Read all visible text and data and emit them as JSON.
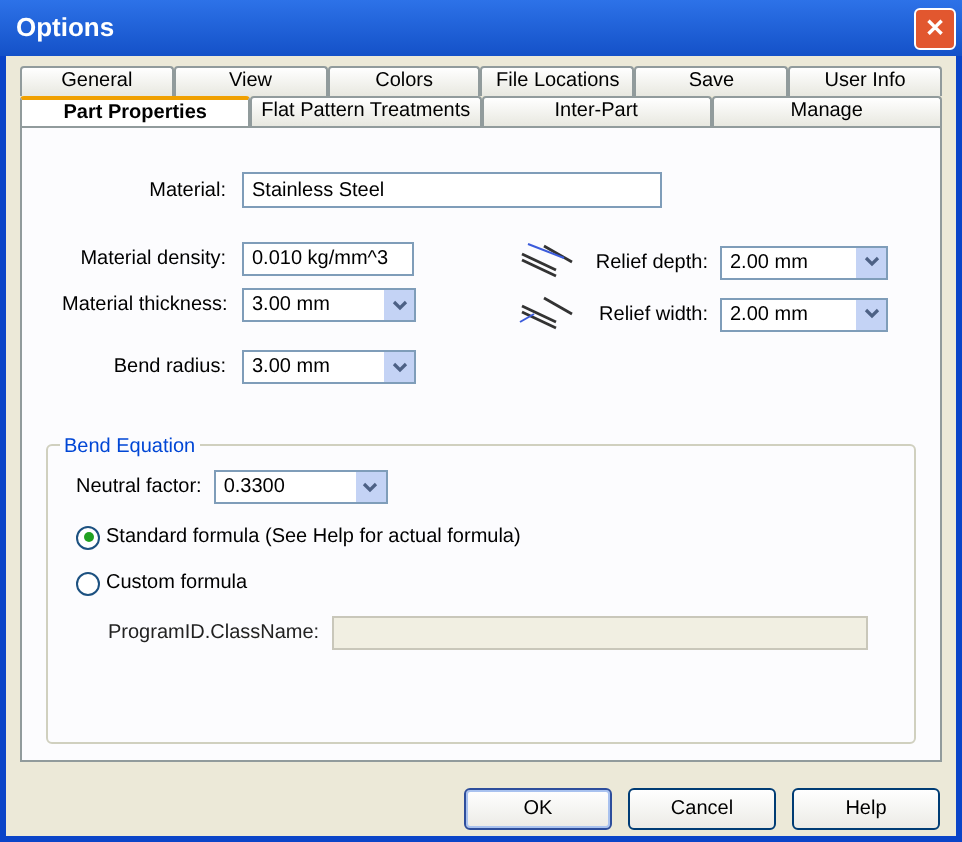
{
  "window": {
    "title": "Options",
    "close": "✕"
  },
  "tab_rows": [
    [
      {
        "label": "General",
        "selected": false
      },
      {
        "label": "View",
        "selected": false
      },
      {
        "label": "Colors",
        "selected": false
      },
      {
        "label": "File Locations",
        "selected": false
      },
      {
        "label": "Save",
        "selected": false
      },
      {
        "label": "User Info",
        "selected": false
      }
    ],
    [
      {
        "label": "Part Properties",
        "selected": true
      },
      {
        "label": "Flat Pattern Treatments",
        "selected": false
      },
      {
        "label": "Inter-Part",
        "selected": false
      },
      {
        "label": "Manage",
        "selected": false
      }
    ]
  ],
  "material": {
    "label": "Material:",
    "value": "Stainless Steel"
  },
  "left_fields": [
    {
      "kind": "text",
      "label": "Material density:",
      "value": "0.010 kg/mm^3"
    },
    {
      "kind": "combo",
      "label": "Material thickness:",
      "value": "3.00 mm"
    },
    {
      "kind": "combo",
      "label": "Bend radius:",
      "value": "3.00 mm"
    }
  ],
  "right_fields": [
    {
      "label": "Relief depth:",
      "value": "2.00 mm"
    },
    {
      "label": "Relief width:",
      "value": "2.00 mm"
    }
  ],
  "bend_equation": {
    "title": "Bend Equation",
    "neutral_factor": {
      "label": "Neutral factor:",
      "value": "0.3300"
    },
    "options": [
      {
        "label": "Standard formula (See Help for actual formula)",
        "selected": true
      },
      {
        "label": "Custom formula",
        "selected": false
      }
    ],
    "program_id": {
      "label": "ProgramID.ClassName:",
      "disabled": true
    }
  },
  "buttons": [
    "OK",
    "Cancel",
    "Help"
  ]
}
